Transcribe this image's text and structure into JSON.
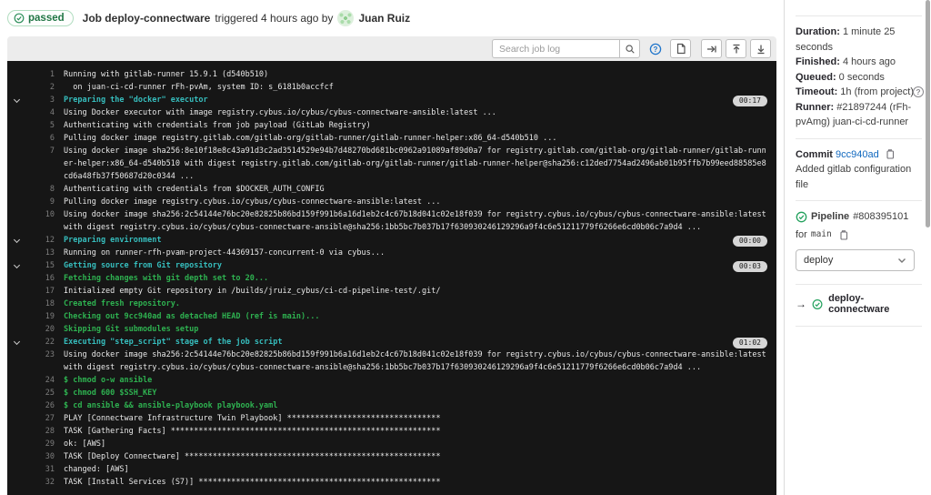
{
  "header": {
    "status_badge": "passed",
    "job_label": "Job deploy-connectware",
    "triggered_text": "triggered 4 hours ago by",
    "user_name": "Juan Ruiz"
  },
  "toolbar": {
    "search_placeholder": "Search job log",
    "icons": [
      "search-icon",
      "help-icon",
      "raw-log-icon",
      "arrow-right-icon",
      "scroll-to-top-icon",
      "scroll-to-bottom-icon"
    ]
  },
  "log": {
    "lines": [
      {
        "num": 1,
        "style": "normal",
        "text": "Running with gitlab-runner 15.9.1 (d540b510)"
      },
      {
        "num": 2,
        "style": "normal",
        "text": "  on juan-ci-cd-runner rFh-pvAm, system ID: s_6181b0accfcf"
      },
      {
        "num": 3,
        "style": "section",
        "chevron": true,
        "badge": "00:17",
        "text": "Preparing the \"docker\" executor"
      },
      {
        "num": 4,
        "style": "normal",
        "text": "Using Docker executor with image registry.cybus.io/cybus/cybus-connectware-ansible:latest ..."
      },
      {
        "num": 5,
        "style": "normal",
        "text": "Authenticating with credentials from job payload (GitLab Registry)"
      },
      {
        "num": 6,
        "style": "normal",
        "text": "Pulling docker image registry.gitlab.com/gitlab-org/gitlab-runner/gitlab-runner-helper:x86_64-d540b510 ..."
      },
      {
        "num": 7,
        "style": "normal",
        "text": "Using docker image sha256:8e10f18e8c43a91d3c2ad3514529e94b7d48270bd681bc0962a91089af89d0a7 for registry.gitlab.com/gitlab-org/gitlab-runner/gitlab-runner-helper:x86_64-d540b510 with digest registry.gitlab.com/gitlab-org/gitlab-runner/gitlab-runner-helper@sha256:c12ded7754ad2496ab01b95ffb7b99eed88585e8cd6a48fb37f50687d20c0344 ..."
      },
      {
        "num": 8,
        "style": "normal",
        "text": "Authenticating with credentials from $DOCKER_AUTH_CONFIG"
      },
      {
        "num": 9,
        "style": "normal",
        "text": "Pulling docker image registry.cybus.io/cybus/cybus-connectware-ansible:latest ..."
      },
      {
        "num": 10,
        "style": "normal",
        "text": "Using docker image sha256:2c54144e76bc20e82825b86bd159f991b6a16d1eb2c4c67b18d041c02e18f039 for registry.cybus.io/cybus/cybus-connectware-ansible:latest with digest registry.cybus.io/cybus/cybus-connectware-ansible@sha256:1bb5bc7b037b17f630930246129296a9f4c6e51211779f6266e6cd0b06c7a9d4 ..."
      },
      {
        "num": 12,
        "style": "section",
        "chevron": true,
        "badge": "00:00",
        "text": "Preparing environment"
      },
      {
        "num": 13,
        "style": "normal",
        "text": "Running on runner-rfh-pvam-project-44369157-concurrent-0 via cybus..."
      },
      {
        "num": 15,
        "style": "section",
        "chevron": true,
        "badge": "00:03",
        "text": "Getting source from Git repository"
      },
      {
        "num": 16,
        "style": "green",
        "text": "Fetching changes with git depth set to 20..."
      },
      {
        "num": 17,
        "style": "normal",
        "text": "Initialized empty Git repository in /builds/jruiz_cybus/ci-cd-pipeline-test/.git/"
      },
      {
        "num": 18,
        "style": "green",
        "text": "Created fresh repository."
      },
      {
        "num": 19,
        "style": "green",
        "text": "Checking out 9cc940ad as detached HEAD (ref is main)..."
      },
      {
        "num": 20,
        "style": "green",
        "text": "Skipping Git submodules setup"
      },
      {
        "num": 22,
        "style": "section",
        "chevron": true,
        "badge": "01:02",
        "text": "Executing \"step_script\" stage of the job script"
      },
      {
        "num": 23,
        "style": "normal",
        "text": "Using docker image sha256:2c54144e76bc20e82825b86bd159f991b6a16d1eb2c4c67b18d041c02e18f039 for registry.cybus.io/cybus/cybus-connectware-ansible:latest with digest registry.cybus.io/cybus/cybus-connectware-ansible@sha256:1bb5bc7b037b17f630930246129296a9f4c6e51211779f6266e6cd0b06c7a9d4 ..."
      },
      {
        "num": 24,
        "style": "green",
        "text": "$ chmod o-w ansible"
      },
      {
        "num": 25,
        "style": "green",
        "text": "$ chmod 600 $SSH_KEY"
      },
      {
        "num": 26,
        "style": "green",
        "text": "$ cd ansible && ansible-playbook playbook.yaml"
      },
      {
        "num": 27,
        "style": "normal",
        "text": "PLAY [Connectware Infrastructure Twin Playbook] *********************************"
      },
      {
        "num": 28,
        "style": "normal",
        "text": "TASK [Gathering Facts] **********************************************************"
      },
      {
        "num": 29,
        "style": "normal",
        "text": "ok: [AWS]"
      },
      {
        "num": 30,
        "style": "normal",
        "text": "TASK [Deploy Connectware] *******************************************************"
      },
      {
        "num": 31,
        "style": "normal",
        "text": "changed: [AWS]"
      },
      {
        "num": 32,
        "style": "normal",
        "text": "TASK [Install Services (S7)] ****************************************************"
      }
    ]
  },
  "sidebar": {
    "details": [
      {
        "label": "Duration:",
        "value": "1 minute 25 seconds"
      },
      {
        "label": "Finished:",
        "value": "4 hours ago"
      },
      {
        "label": "Queued:",
        "value": "0 seconds"
      },
      {
        "label": "Timeout:",
        "value": "1h (from project)",
        "help": true
      },
      {
        "label": "Runner:",
        "value": "#21897244 (rFh-pvAmg) juan-ci-cd-runner"
      }
    ],
    "commit": {
      "label": "Commit",
      "sha": "9cc940ad",
      "message": "Added gitlab configuration file"
    },
    "pipeline": {
      "label": "Pipeline",
      "id": "#808395101",
      "for_text": "for",
      "ref": "main",
      "stage_value": "deploy",
      "job_name": "deploy-connectware"
    }
  },
  "colors": {
    "log_bg": "#161616",
    "section_teal": "#36bdbd",
    "ansi_green": "#2eb150",
    "link_blue": "#1068bf",
    "status_green": "#217645",
    "badge_border": "#b1ddc0"
  }
}
